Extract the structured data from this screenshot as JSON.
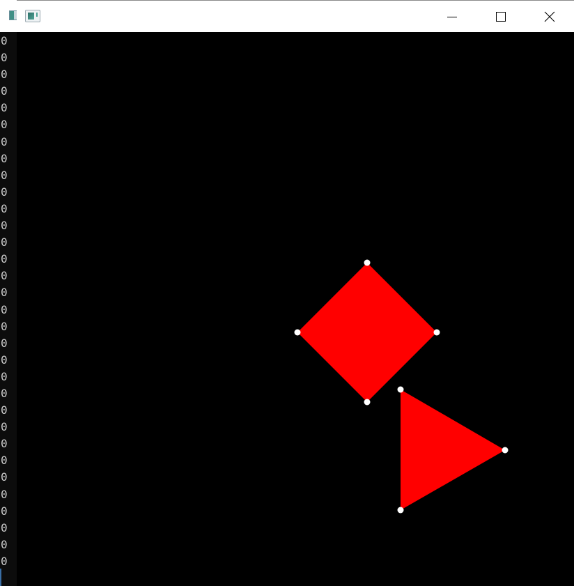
{
  "console": {
    "lines": [
      "0",
      "0",
      "0",
      "0",
      "0",
      "0",
      "0",
      "0",
      "0",
      "0",
      "0",
      "0",
      "0",
      "0",
      "0",
      "0",
      "0",
      "0",
      "0",
      "0",
      "0",
      "0",
      "0",
      "0",
      "0",
      "0",
      "0",
      "0",
      "0",
      "0",
      "0",
      "0"
    ]
  },
  "window": {
    "title": ""
  },
  "colors": {
    "background": "#000000",
    "shape_fill": "#ff0000",
    "vertex_handle": "#ffffff"
  },
  "icons": {
    "app": "app-window-icon",
    "minimize": "minimize-icon",
    "maximize": "maximize-icon",
    "close": "close-icon"
  }
}
